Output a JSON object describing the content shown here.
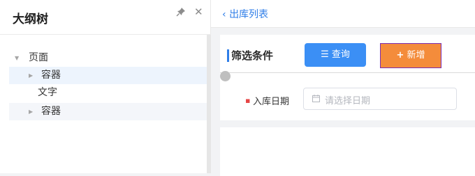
{
  "outline": {
    "title": "大纲树",
    "close_glyph": "✕",
    "tree": [
      {
        "label": "页面",
        "caret": "▼"
      },
      {
        "label": "容器",
        "caret": "▶"
      },
      {
        "label": "文字"
      },
      {
        "label": "容器",
        "caret": "▶"
      }
    ]
  },
  "topbar": {
    "back_glyph": "‹",
    "back_label": "出库列表"
  },
  "filter": {
    "title": "筛选条件",
    "query_icon": "☰",
    "query_label": "查询",
    "add_icon": "+",
    "add_label": "新增",
    "required_mark": "▪",
    "date_label": "入库日期",
    "date_placeholder": "请选择日期"
  },
  "colors": {
    "accent": "#3b8ff5",
    "add_button": "#f48c3b",
    "selected_row": "#edf4fd"
  }
}
